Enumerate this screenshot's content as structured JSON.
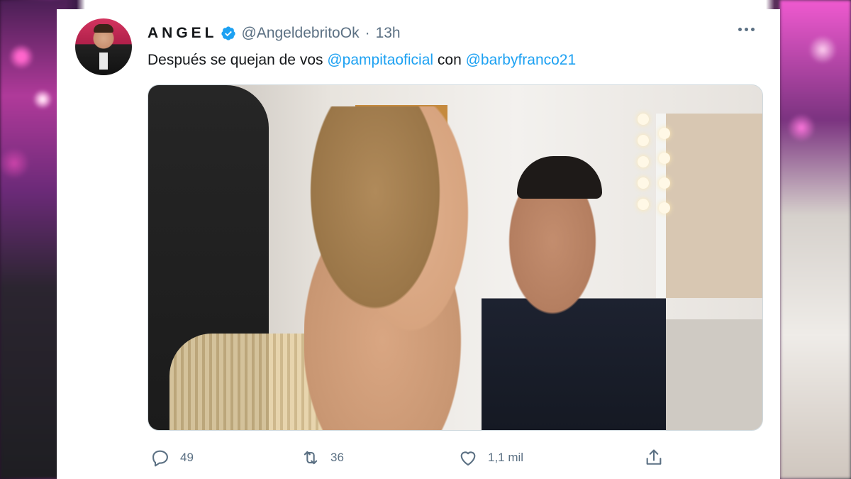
{
  "tweet": {
    "display_name": "ANGEL",
    "verified": true,
    "handle": "@AngeldebritoOk",
    "separator": "·",
    "time": "13h",
    "text_before": "Después se quejan de vos ",
    "mention_1": "@pampitaoficial",
    "text_between": " con ",
    "mention_2": "@barbyfranco21",
    "media_type": "photo"
  },
  "actions": {
    "reply_count": "49",
    "retweet_count": "36",
    "like_count": "1,1 mil"
  },
  "icons": {
    "more": "more-horizontal-icon",
    "verified": "verified-badge-icon",
    "reply": "reply-icon",
    "retweet": "retweet-icon",
    "like": "heart-icon",
    "share": "share-icon"
  },
  "colors": {
    "accent": "#1da1f2",
    "text": "#14171a",
    "secondary": "#5b7083"
  }
}
